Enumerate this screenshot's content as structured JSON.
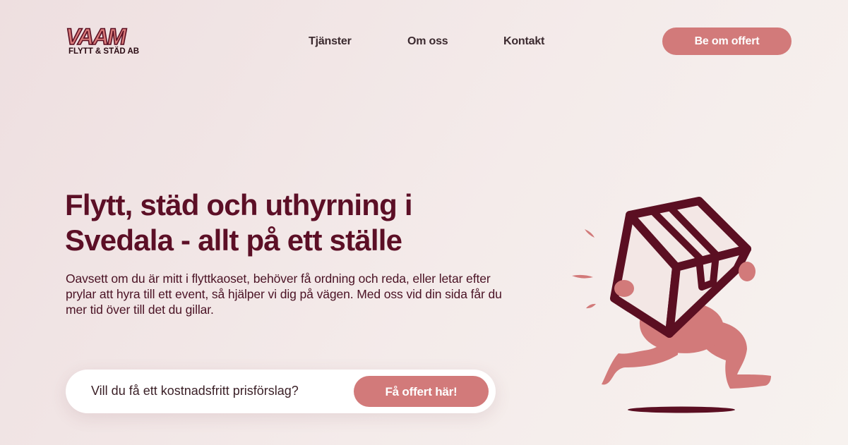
{
  "brand": {
    "logo_main": "VAAM",
    "logo_sub": "FLYTT & STÄD AB"
  },
  "nav": {
    "items": [
      {
        "label": "Tjänster"
      },
      {
        "label": "Om oss"
      },
      {
        "label": "Kontakt"
      }
    ],
    "cta_label": "Be om offert"
  },
  "hero": {
    "title": "Flytt, städ och uthyrning i Svedala - allt på ett ställe",
    "text": "Oavsett om du är mitt i flyttkaoset, behöver få ordning och reda, eller letar efter prylar att hyra till ett event, så hjälper vi dig på vägen. Med oss vid din sida får du mer tid över till det du gillar."
  },
  "quote": {
    "prompt": "Vill du få ett kostnadsfritt prisförslag?",
    "button_label": "Få offert här!"
  },
  "illustration": {
    "icon": "running-mover-with-box-icon"
  },
  "colors": {
    "accent": "#d27a7a",
    "heading": "#5c0f26",
    "box_outline": "#5b0f22",
    "background": "#f1e6e6"
  }
}
